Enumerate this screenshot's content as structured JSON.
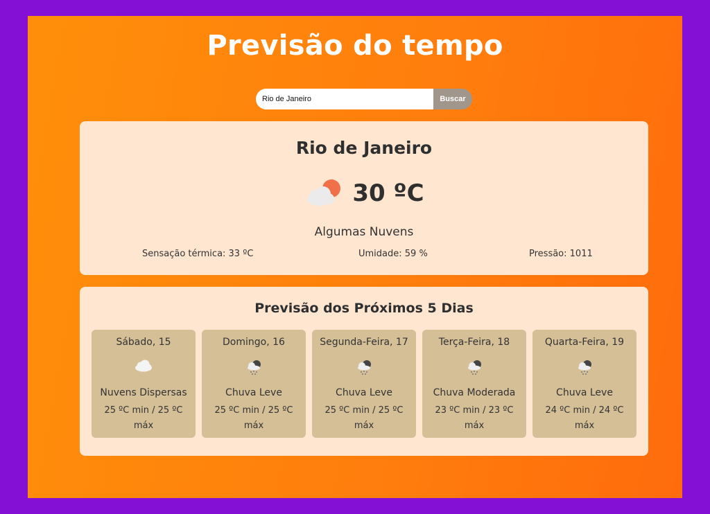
{
  "page": {
    "title": "Previsão do tempo"
  },
  "search": {
    "value": "Rio de Janeiro",
    "button_label": "Buscar"
  },
  "current": {
    "city": "Rio de Janeiro",
    "temperature": "30 ºC",
    "icon": "few-clouds-icon",
    "description": "Algumas Nuvens",
    "feels_like": "Sensação térmica: 33 ºC",
    "humidity": "Umidade: 59 %",
    "pressure": "Pressão: 1011"
  },
  "forecast": {
    "title": "Previsão dos Próximos 5 Dias",
    "days": [
      {
        "name": "Sábado, 15",
        "icon": "scattered-clouds-icon",
        "description": "Nuvens Dispersas",
        "temps": "25 ºC min / 25 ºC máx"
      },
      {
        "name": "Domingo, 16",
        "icon": "rain-icon",
        "description": "Chuva Leve",
        "temps": "25 ºC min / 25 ºC máx"
      },
      {
        "name": "Segunda-Feira, 17",
        "icon": "rain-icon",
        "description": "Chuva Leve",
        "temps": "25 ºC min / 25 ºC máx"
      },
      {
        "name": "Terça-Feira, 18",
        "icon": "rain-icon",
        "description": "Chuva Moderada",
        "temps": "23 ºC min / 23 ºC máx"
      },
      {
        "name": "Quarta-Feira, 19",
        "icon": "rain-icon",
        "description": "Chuva Leve",
        "temps": "24 ºC min / 24 ºC máx"
      }
    ]
  },
  "colors": {
    "frame": "#8410d6",
    "accent": "#ff8400",
    "card": "#ffe6d0",
    "day_card": "#d4bf97",
    "button": "#a0968c"
  }
}
